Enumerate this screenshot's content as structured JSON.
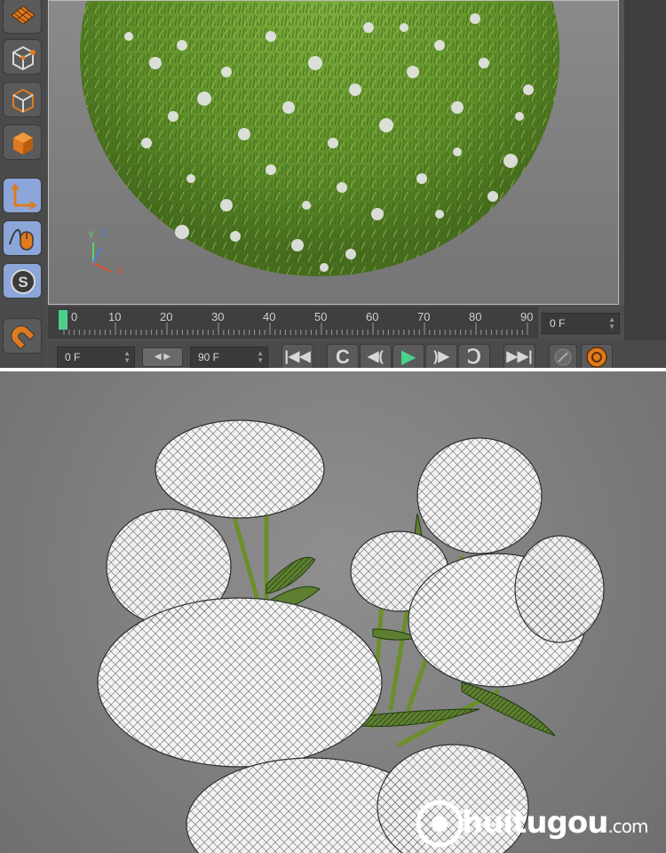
{
  "timeline": {
    "ticks": [
      "0",
      "10",
      "20",
      "30",
      "40",
      "50",
      "60",
      "70",
      "80",
      "90"
    ],
    "current_frame": "0 F"
  },
  "playback": {
    "start_frame": "0 F",
    "end_frame": "90 F",
    "buttons": [
      "go-to-start",
      "previous-keyframe",
      "previous-frame",
      "play",
      "next-frame",
      "next-keyframe",
      "go-to-end"
    ]
  },
  "axes": {
    "y": "Y",
    "z": "Z",
    "x": "X"
  },
  "watermark": {
    "brand": "huitugou",
    "suffix": ".com"
  },
  "colors": {
    "accent_orange": "#e07a1f",
    "active_blue": "#8ca6d9",
    "grass_green": "#5f8f2a",
    "playhead": "#4ad18a"
  }
}
